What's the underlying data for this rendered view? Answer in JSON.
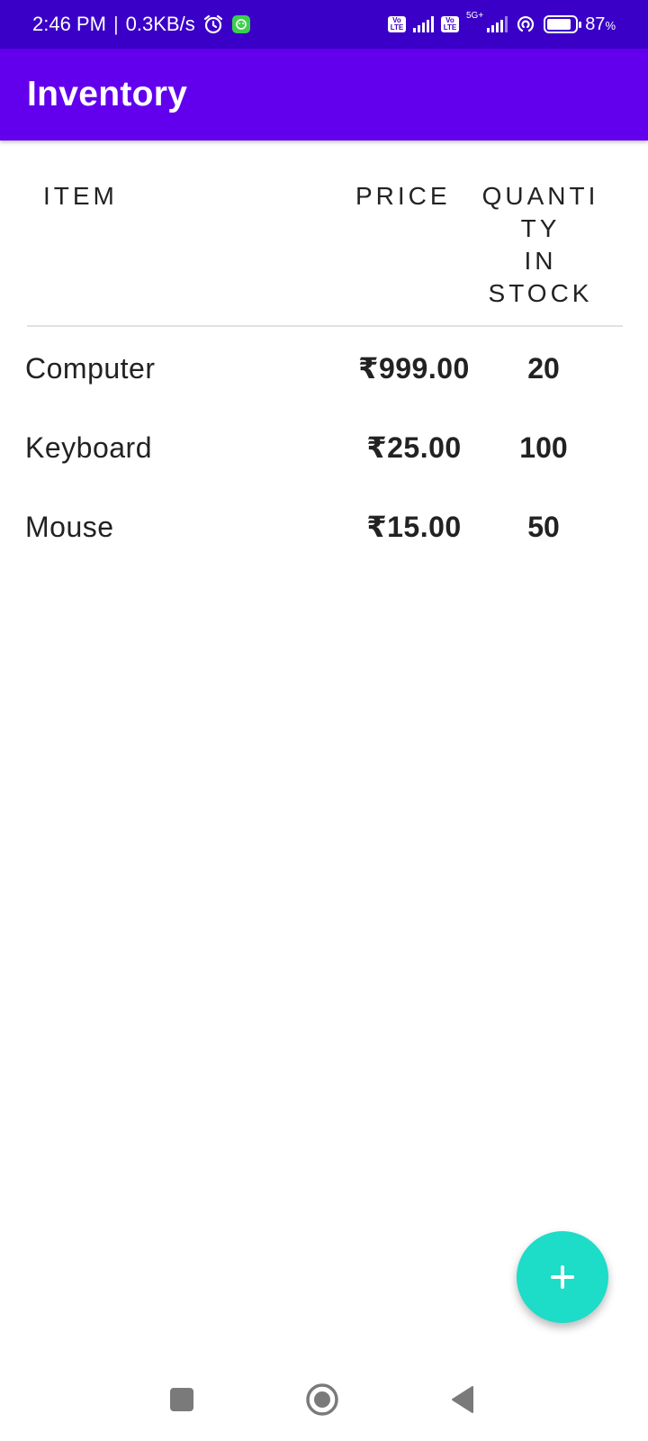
{
  "status_bar": {
    "time": "2:46 PM",
    "separator": "|",
    "net_speed": "0.3KB/s",
    "volte_label_1": "Vo\nLTE",
    "volte_label_2": "Vo\nLTE",
    "network_type": "5G+",
    "battery_percent": "87",
    "battery_unit": "%",
    "battery_level": 0.87,
    "icons": [
      "alarm-icon",
      "notification-app-icon",
      "volte-icon",
      "signal-icon",
      "volte-icon",
      "signal-5g-icon",
      "hotspot-icon",
      "battery-icon"
    ]
  },
  "app_bar": {
    "title": "Inventory"
  },
  "table": {
    "headers": {
      "item": "ITEM",
      "price": "PRICE",
      "quantity_lines": [
        "QUANTI",
        "TY",
        "IN",
        "STOCK"
      ]
    },
    "rows": [
      {
        "name": "Computer",
        "price": "₹999.00",
        "quantity": "20"
      },
      {
        "name": "Keyboard",
        "price": "₹25.00",
        "quantity": "100"
      },
      {
        "name": "Mouse",
        "price": "₹15.00",
        "quantity": "50"
      }
    ]
  },
  "fab": {
    "icon": "plus-icon"
  },
  "nav_bar": {
    "icons": [
      "recents-icon",
      "home-icon",
      "back-icon"
    ]
  },
  "colors": {
    "status_bar": "#3a00c8",
    "app_bar": "#6200ee",
    "fab": "#1ddcc8",
    "text": "#222222",
    "nav_icons": "#7a7a7a"
  }
}
